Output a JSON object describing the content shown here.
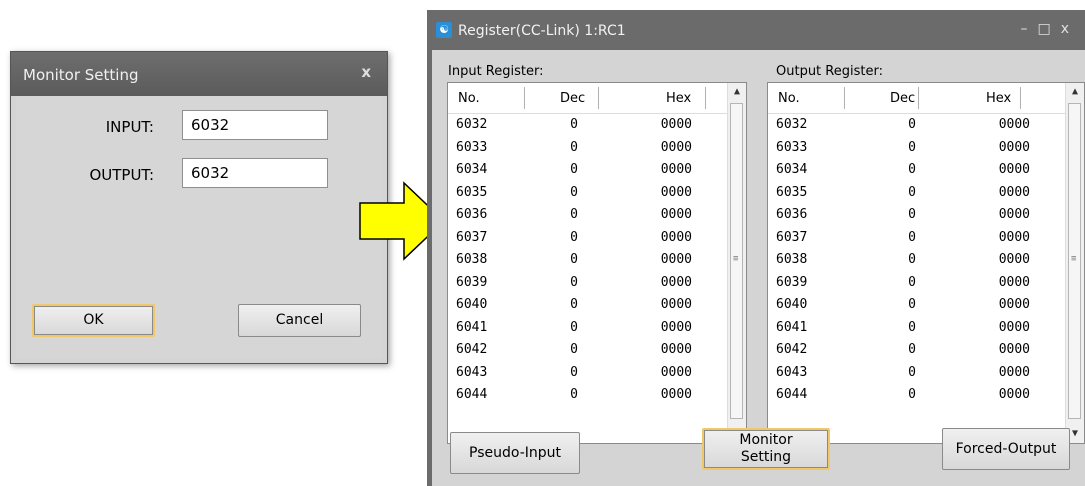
{
  "monitor_dialog": {
    "title": "Monitor Setting",
    "close_glyph": "x",
    "input_label": "INPUT:",
    "input_value": "6032",
    "output_label": "OUTPUT:",
    "output_value": "6032",
    "ok_label": "OK",
    "cancel_label": "Cancel"
  },
  "arrow": {
    "color": "#ffff00",
    "outline": "#000000"
  },
  "register_window": {
    "title": "Register(CC-Link) 1:RC1",
    "window_controls": [
      "–",
      "□",
      "x"
    ],
    "input_label": "Input Register:",
    "output_label": "Output Register:",
    "columns": [
      "No.",
      "Dec",
      "Hex"
    ],
    "input_rows": [
      {
        "no": "6032",
        "dec": "0",
        "hex": "0000"
      },
      {
        "no": "6033",
        "dec": "0",
        "hex": "0000"
      },
      {
        "no": "6034",
        "dec": "0",
        "hex": "0000"
      },
      {
        "no": "6035",
        "dec": "0",
        "hex": "0000"
      },
      {
        "no": "6036",
        "dec": "0",
        "hex": "0000"
      },
      {
        "no": "6037",
        "dec": "0",
        "hex": "0000"
      },
      {
        "no": "6038",
        "dec": "0",
        "hex": "0000"
      },
      {
        "no": "6039",
        "dec": "0",
        "hex": "0000"
      },
      {
        "no": "6040",
        "dec": "0",
        "hex": "0000"
      },
      {
        "no": "6041",
        "dec": "0",
        "hex": "0000"
      },
      {
        "no": "6042",
        "dec": "0",
        "hex": "0000"
      },
      {
        "no": "6043",
        "dec": "0",
        "hex": "0000"
      },
      {
        "no": "6044",
        "dec": "0",
        "hex": "0000"
      }
    ],
    "output_rows": [
      {
        "no": "6032",
        "dec": "0",
        "hex": "0000"
      },
      {
        "no": "6033",
        "dec": "0",
        "hex": "0000"
      },
      {
        "no": "6034",
        "dec": "0",
        "hex": "0000"
      },
      {
        "no": "6035",
        "dec": "0",
        "hex": "0000"
      },
      {
        "no": "6036",
        "dec": "0",
        "hex": "0000"
      },
      {
        "no": "6037",
        "dec": "0",
        "hex": "0000"
      },
      {
        "no": "6038",
        "dec": "0",
        "hex": "0000"
      },
      {
        "no": "6039",
        "dec": "0",
        "hex": "0000"
      },
      {
        "no": "6040",
        "dec": "0",
        "hex": "0000"
      },
      {
        "no": "6041",
        "dec": "0",
        "hex": "0000"
      },
      {
        "no": "6042",
        "dec": "0",
        "hex": "0000"
      },
      {
        "no": "6043",
        "dec": "0",
        "hex": "0000"
      },
      {
        "no": "6044",
        "dec": "0",
        "hex": "0000"
      }
    ],
    "pseudo_input_label": "Pseudo-Input",
    "monitor_setting_label_line1": "Monitor",
    "monitor_setting_label_line2": "Setting",
    "forced_output_label": "Forced-Output"
  }
}
